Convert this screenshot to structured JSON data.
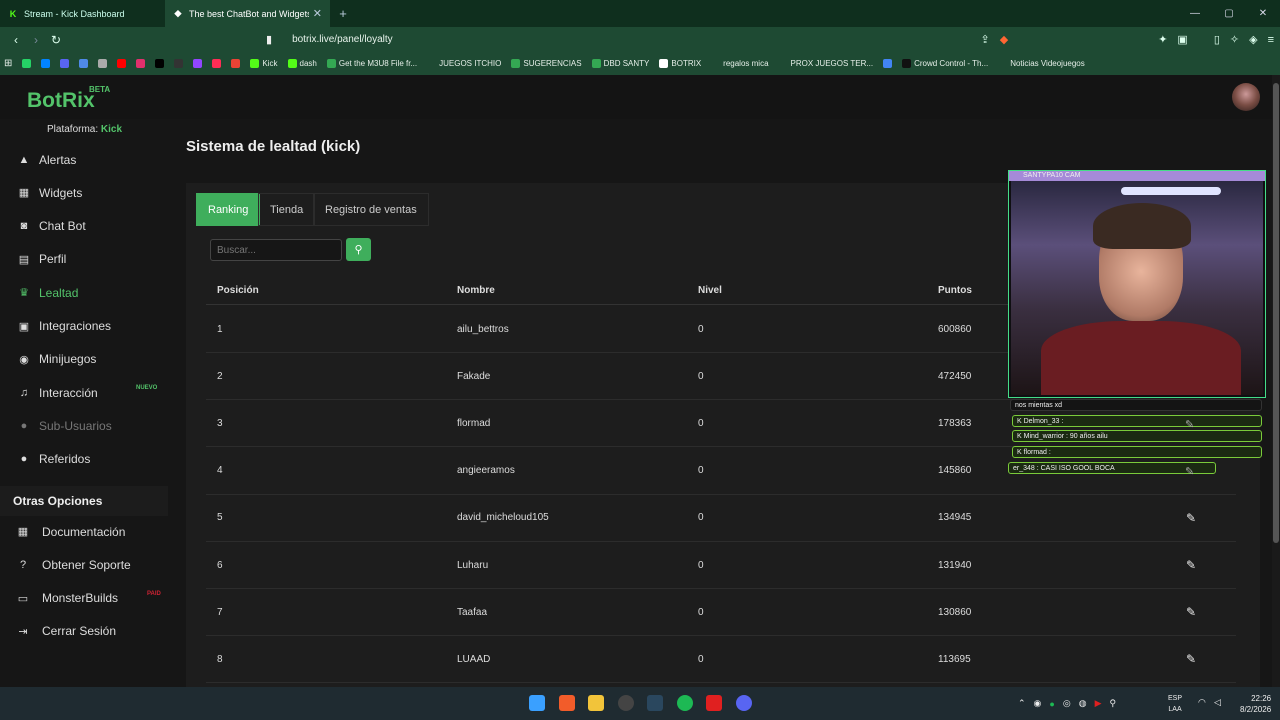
{
  "browser": {
    "tabs": [
      {
        "label": "Stream - Kick Dashboard",
        "icon": "kick-icon",
        "active": false
      },
      {
        "label": "The best ChatBot and Widgets fo",
        "icon": "botrix-icon",
        "active": true
      }
    ],
    "url": "botrix.live/panel/loyalty",
    "bookmarks": [
      {
        "label": "",
        "color": "#25d366"
      },
      {
        "label": "",
        "color": "#0084ff"
      },
      {
        "label": "",
        "color": "#5865f2"
      },
      {
        "label": "",
        "color": "#4f8ae8"
      },
      {
        "label": "",
        "color": "#aaaaaa"
      },
      {
        "label": "",
        "color": "#ff0000"
      },
      {
        "label": "",
        "color": "#e1306c"
      },
      {
        "label": "",
        "color": "#000000"
      },
      {
        "label": "",
        "color": "#333333"
      },
      {
        "label": "",
        "color": "#9146ff"
      },
      {
        "label": "",
        "color": "#ff2d55"
      },
      {
        "label": "",
        "color": "#ea4335"
      },
      {
        "label": "Kick",
        "color": "#53fc18"
      },
      {
        "label": "dash",
        "color": "#53fc18"
      },
      {
        "label": "Get the M3U8 File fr...",
        "color": "#34a853"
      },
      {
        "label": "JUEGOS ITCHIO",
        "color": "#1e4a33"
      },
      {
        "label": "SUGERENCIAS",
        "color": "#34a853"
      },
      {
        "label": "DBD SANTY",
        "color": "#34a853"
      },
      {
        "label": "BOTRIX",
        "color": "#ffffff"
      },
      {
        "label": "regalos mica",
        "color": "#1e4a33"
      },
      {
        "label": "PROX JUEGOS TER...",
        "color": "#1e4a33"
      },
      {
        "label": "",
        "color": "#4285f4"
      },
      {
        "label": "Crowd Control - Th...",
        "color": "#111111"
      },
      {
        "label": "Noticias Videojuegos",
        "color": "#1e4a33"
      }
    ]
  },
  "app": {
    "logo": "BotRix",
    "beta": "BETA",
    "platform_label": "Plataforma:",
    "platform_value": "Kick",
    "page_title": "Sistema de lealtad (kick)"
  },
  "sidebar": {
    "items": [
      {
        "label": "Alertas",
        "icon": "warning-icon",
        "glyph": "▲"
      },
      {
        "label": "Widgets",
        "icon": "grid-icon",
        "glyph": "▦"
      },
      {
        "label": "Chat Bot",
        "icon": "robot-icon",
        "glyph": "◙"
      },
      {
        "label": "Perfil",
        "icon": "id-card-icon",
        "glyph": "▤"
      },
      {
        "label": "Lealtad",
        "icon": "trophy-icon",
        "glyph": "♛"
      },
      {
        "label": "Integraciones",
        "icon": "integrations-icon",
        "glyph": "▣"
      },
      {
        "label": "Minijuegos",
        "icon": "gamepad-icon",
        "glyph": "◉"
      },
      {
        "label": "Interacción",
        "icon": "music-icon",
        "glyph": "♫",
        "badge": "NUEVO"
      },
      {
        "label": "Sub-Usuarios",
        "icon": "users-icon",
        "glyph": "●"
      },
      {
        "label": "Referidos",
        "icon": "referral-icon",
        "glyph": "●"
      }
    ],
    "section_title": "Otras Opciones",
    "other_items": [
      {
        "label": "Documentación",
        "icon": "book-icon",
        "glyph": "▦"
      },
      {
        "label": "Obtener Soporte",
        "icon": "help-icon",
        "glyph": "?"
      },
      {
        "label": "MonsterBuilds",
        "icon": "monitor-icon",
        "glyph": "▭",
        "badge": "PAID"
      },
      {
        "label": "Cerrar Sesión",
        "icon": "logout-icon",
        "glyph": "⇥"
      }
    ]
  },
  "tabs": [
    "Ranking",
    "Tienda",
    "Registro de ventas"
  ],
  "search": {
    "placeholder": "Buscar..."
  },
  "table": {
    "headers": [
      "Posición",
      "Nombre",
      "Nivel",
      "Puntos"
    ],
    "rows": [
      [
        "1",
        "ailu_bettros",
        "0",
        "600860"
      ],
      [
        "2",
        "Fakade",
        "0",
        "472450"
      ],
      [
        "3",
        "flormad",
        "0",
        "178363"
      ],
      [
        "4",
        "angieeramos",
        "0",
        "145860"
      ],
      [
        "5",
        "david_micheloud105",
        "0",
        "134945"
      ],
      [
        "6",
        "Luharu",
        "0",
        "131940"
      ],
      [
        "7",
        "Taafaa",
        "0",
        "130860"
      ],
      [
        "8",
        "LUAAD",
        "0",
        "113695"
      ]
    ]
  },
  "overlay": {
    "cam_title": "SANTYPA10 CAM",
    "chat": [
      "nos mientas xd",
      "K Delmon_33 :",
      "K Mind_warrior : 90 años ailu",
      "K flormad :",
      "er_348 : CASI ISO GOOL BOCA"
    ]
  },
  "taskbar": {
    "lang": "ESP",
    "lang2": "LAA",
    "time": "22:26",
    "date": "8/2/2026"
  }
}
